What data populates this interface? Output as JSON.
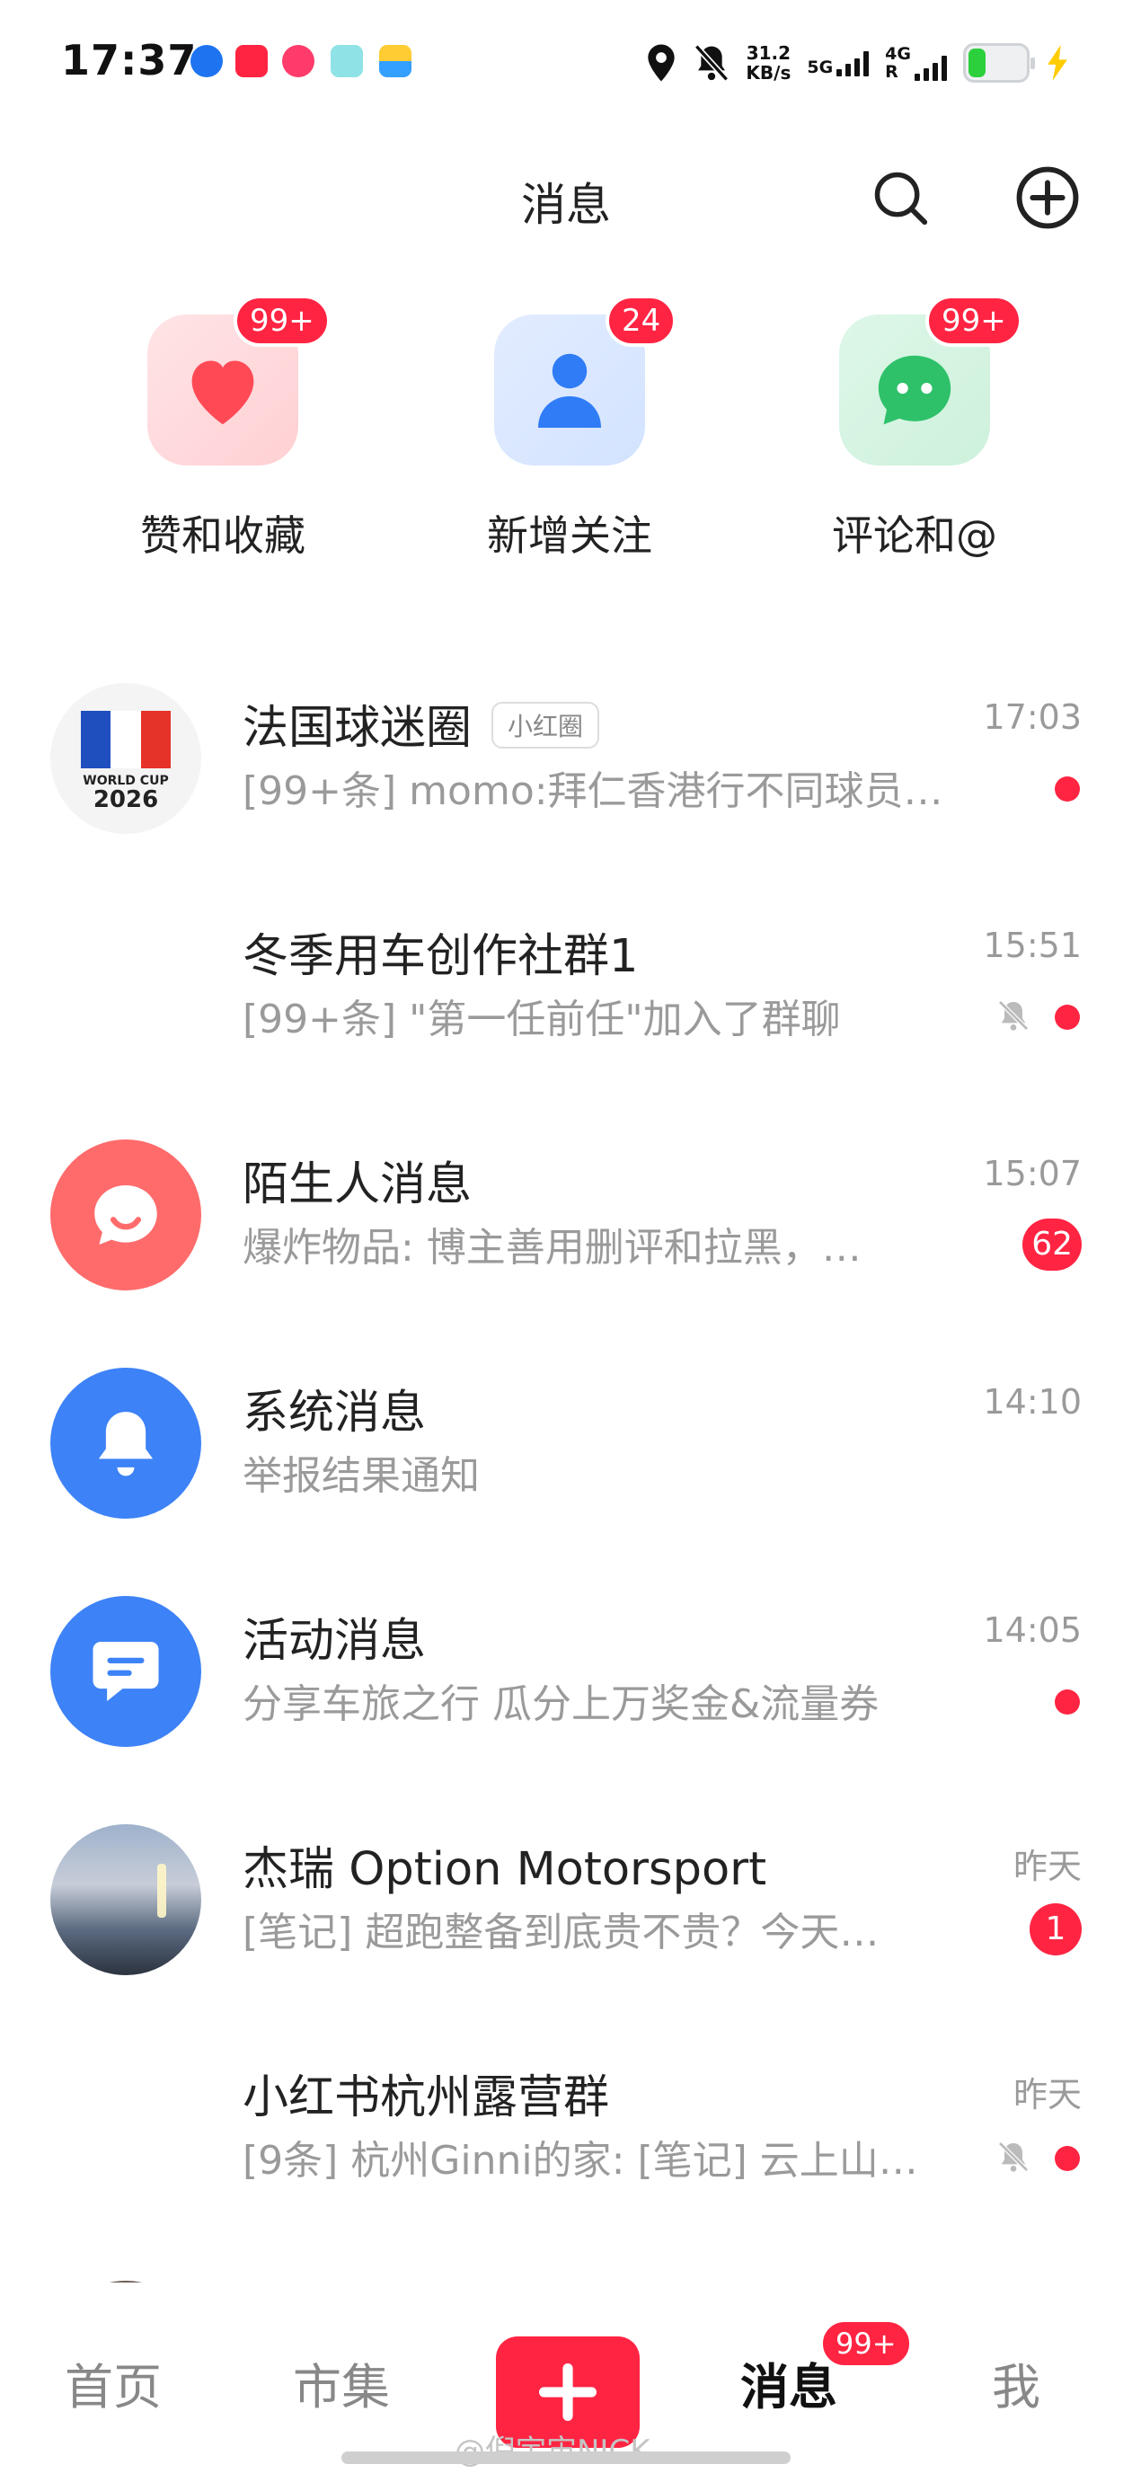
{
  "status_bar": {
    "time": "17:37",
    "net_speed_value": "31.2",
    "net_speed_unit": "KB/s",
    "signal_1_label": "5G",
    "signal_2_label": "4G",
    "signal_2_sub": "R",
    "battery_level": 0.3,
    "app_icons": [
      "edge-browser-icon",
      "xiaohongshu-icon",
      "instagram-like-icon",
      "screen-icon",
      "wallet-icon"
    ]
  },
  "header": {
    "title": "消息",
    "search_icon": "search-icon",
    "add_icon": "plus-circle-icon"
  },
  "categories": [
    {
      "label": "赞和收藏",
      "badge": "99+",
      "icon": "heart-icon",
      "color": "#ff4a55"
    },
    {
      "label": "新增关注",
      "badge": "24",
      "icon": "person-icon",
      "color": "#2f7cf6"
    },
    {
      "label": "评论和@",
      "badge": "99+",
      "icon": "chat-icon",
      "color": "#2ec16a"
    }
  ],
  "conversations": [
    {
      "name": "法国球迷圈",
      "tag": "小红圈",
      "preview": "[99+条] momo:拜仁香港行不同球员…",
      "time": "17:03",
      "avatar_text_1": "WORLD CUP",
      "avatar_text_2": "2026",
      "unread_dot": true,
      "muted": false
    },
    {
      "name": "冬季用车创作社群1",
      "preview": "[99+条] \"第一任前任\"加入了群聊",
      "time": "15:51",
      "unread_dot": true,
      "muted": true
    },
    {
      "name": "陌生人消息",
      "preview": "爆炸物品: 博主善用删评和拉黑，…",
      "time": "15:07",
      "unread_count": "62",
      "avatar_icon": "chat-bubble-icon",
      "avatar_color": "#ff6b6b"
    },
    {
      "name": "系统消息",
      "preview": "举报结果通知",
      "time": "14:10",
      "avatar_icon": "bell-icon",
      "avatar_color": "#3d82f6"
    },
    {
      "name": "活动消息",
      "preview": "分享车旅之行 瓜分上万奖金&流量券",
      "time": "14:05",
      "unread_dot": true,
      "avatar_icon": "message-icon",
      "avatar_color": "#3d82f6"
    },
    {
      "name": "杰瑞 Option Motorsport",
      "preview": "[笔记] 超跑整备到底贵不贵？今天…",
      "time": "昨天",
      "unread_count": "1"
    },
    {
      "name": "小红书杭州露营群",
      "preview": "[9条] 杭州Ginni的家: [笔记] 云上山…",
      "time": "昨天",
      "unread_dot": true,
      "muted": true
    }
  ],
  "bottom_nav": {
    "items": [
      "首页",
      "市集",
      "消息",
      "我"
    ],
    "active": "消息",
    "add_icon": "plus-icon",
    "messages_badge": "99+"
  },
  "watermark": "@倪宇宙NICK"
}
